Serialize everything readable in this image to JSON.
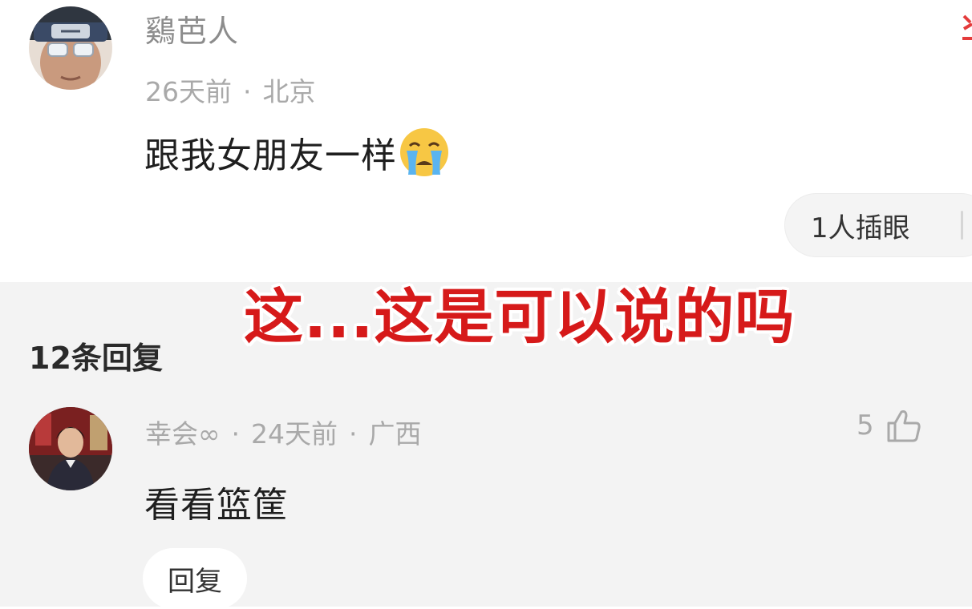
{
  "main_comment": {
    "avatar": "avatar-headband-man",
    "username": "鷄芭人",
    "time": "26天前",
    "separator": "·",
    "location": "北京",
    "content": "跟我女朋友一样",
    "emoji": "loudly-crying-face-emoji",
    "reaction_button": "1人插眼"
  },
  "overlay_caption": "这...这是可以说的吗",
  "replies_header": "12条回复",
  "reply": {
    "avatar": "avatar-young-man-photo",
    "username": "幸会∞",
    "separator": "·",
    "time": "24天前",
    "location": "广西",
    "likes": "5",
    "like_icon": "thumbs-up-icon",
    "content": "看看篮筐",
    "reply_button": "回复"
  },
  "colors": {
    "caption_red": "#d61a1a",
    "meta_gray": "#a9a9a9",
    "reply_bg": "#f3f3f3"
  }
}
